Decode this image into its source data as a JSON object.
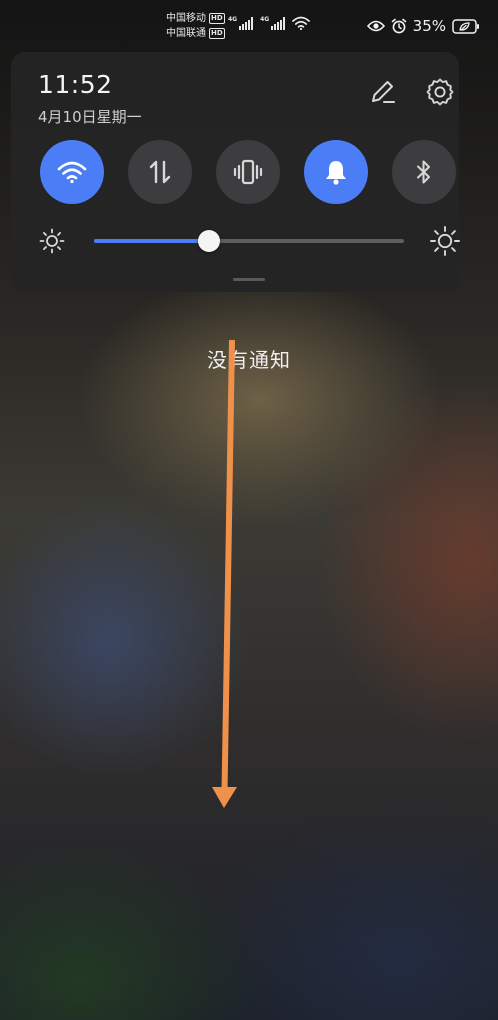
{
  "status_bar": {
    "carrier_1": "中国移动",
    "carrier_2": "中国联通",
    "hd_badge": "HD",
    "network_1": "4G",
    "network_2": "4G",
    "battery_percent": "35%",
    "icons": [
      "wifi-icon",
      "eye-icon",
      "alarm-icon",
      "battery-icon"
    ]
  },
  "panel": {
    "time": "11:52",
    "date": "4月10日星期一",
    "tiles": [
      {
        "name": "wifi",
        "icon": "wifi-icon",
        "active": true
      },
      {
        "name": "mobile-data",
        "icon": "data-transfer-icon",
        "active": false
      },
      {
        "name": "vibrate",
        "icon": "vibrate-icon",
        "active": false
      },
      {
        "name": "sound",
        "icon": "bell-icon",
        "active": true
      },
      {
        "name": "bluetooth",
        "icon": "bluetooth-icon",
        "active": false
      }
    ],
    "brightness_level": 0.37
  },
  "notifications": {
    "empty_text": "没有通知"
  },
  "colors": {
    "accent": "#4b7ef6",
    "panel_bg": "#242425",
    "tile_off": "#3d3d3f",
    "gesture_arrow": "#f0914b"
  }
}
